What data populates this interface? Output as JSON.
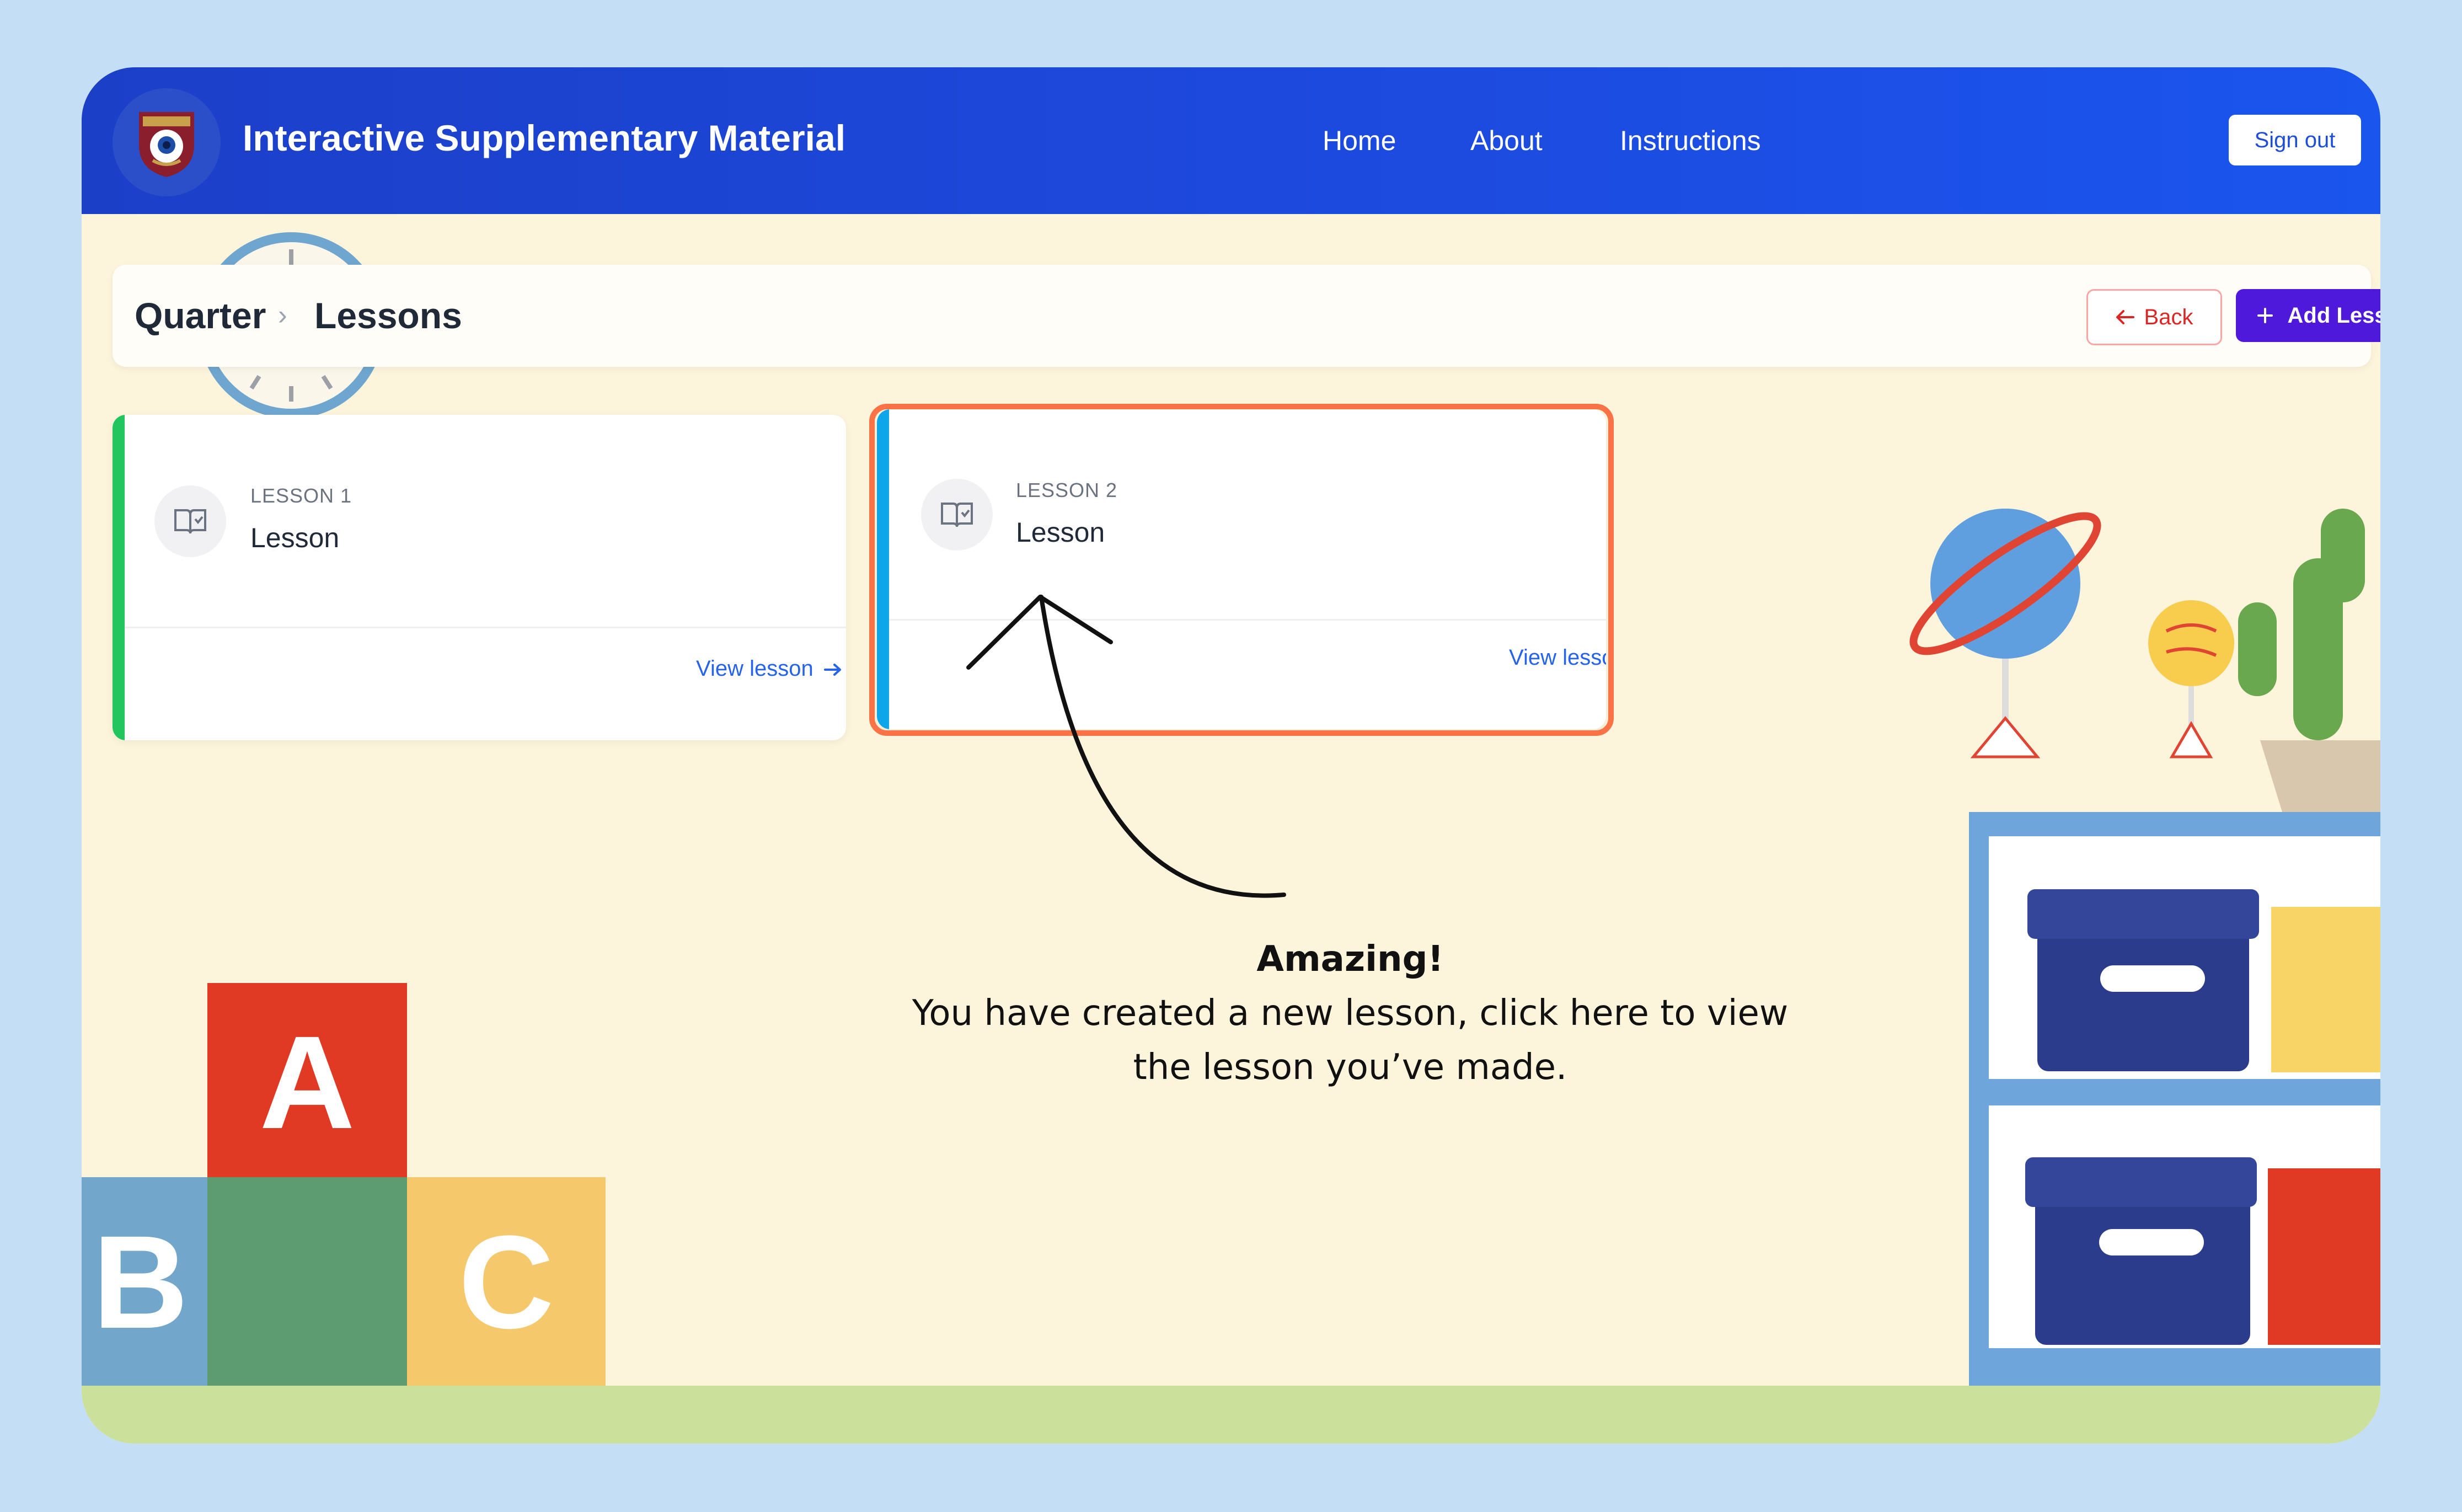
{
  "header": {
    "app_title": "Interactive Supplementary Material",
    "nav": [
      "Home",
      "About",
      "Instructions"
    ],
    "sign_out_label": "Sign out"
  },
  "breadcrumb": {
    "items": [
      "Quarter",
      "Lessons"
    ],
    "separator": "›"
  },
  "actions": {
    "back_label": "Back",
    "add_lesson_label": "Add Lesson"
  },
  "lessons": [
    {
      "number_label": "LESSON 1",
      "title": "Lesson",
      "link_label": "View lesson",
      "accent_color": "#22c55e"
    },
    {
      "number_label": "LESSON 2",
      "title": "Lesson",
      "link_label": "View lesson",
      "accent_color": "#0ea5e9"
    }
  ],
  "tooltip": {
    "line1": "Amazing!",
    "line2": "You have created a new lesson, click here to view the lesson you’ve made."
  },
  "blocks": [
    "A",
    "B",
    "C"
  ],
  "colors": {
    "page_background": "#c4dff5",
    "navbar": "#1d4be0",
    "content_background": "#fdf4dc",
    "add_button": "#4f19dc",
    "back_button_text": "#dc2626",
    "highlight_border": "#f97346",
    "link": "#2563eb"
  }
}
